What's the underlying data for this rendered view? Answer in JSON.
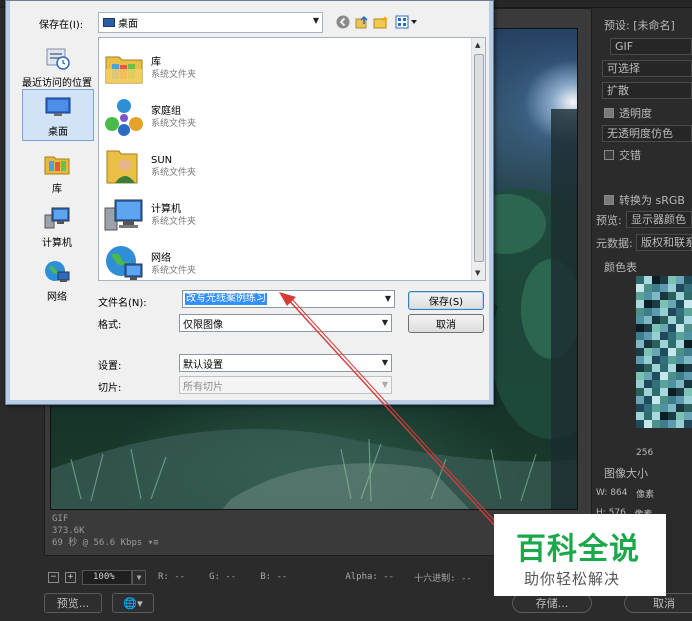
{
  "dialog": {
    "save_in_label": "保存在(I):",
    "location_value": "桌面",
    "places": [
      {
        "label": "最近访问的位置",
        "icon": "recent-places-icon"
      },
      {
        "label": "桌面",
        "icon": "desktop-icon",
        "selected": true
      },
      {
        "label": "库",
        "icon": "libraries-icon"
      },
      {
        "label": "计算机",
        "icon": "computer-icon"
      },
      {
        "label": "网络",
        "icon": "network-icon"
      }
    ],
    "files": [
      {
        "name": "库",
        "type": "系统文件夹",
        "icon": "libraries-folder-icon"
      },
      {
        "name": "家庭组",
        "type": "系统文件夹",
        "icon": "homegroup-icon"
      },
      {
        "name": "SUN",
        "type": "系统文件夹",
        "icon": "user-folder-icon"
      },
      {
        "name": "计算机",
        "type": "系统文件夹",
        "icon": "computer-icon"
      },
      {
        "name": "网络",
        "type": "系统文件夹",
        "icon": "network-icon"
      }
    ],
    "filename_label": "文件名(N):",
    "filename_value": "改写光线案例练习",
    "format_label": "格式:",
    "format_value": "仅限图像",
    "settings_label": "设置:",
    "settings_value": "默认设置",
    "slices_label": "切片:",
    "slices_value": "所有切片",
    "save_button": "保存(S)",
    "cancel_button": "取消"
  },
  "right_panel": {
    "preset_label": "预设:",
    "preset_value": "[未命名]",
    "format_value": "GIF",
    "reduction_value": "可选择",
    "dither_value": "扩散",
    "transparency_label": "透明度",
    "matte_value": "无透明度仿色",
    "interlaced_label": "交错",
    "convert_srgb_label": "转换为 sRGB",
    "preview_label": "预览:",
    "preview_value": "显示器颜色",
    "metadata_label": "元数据:",
    "metadata_value": "版权和联系",
    "color_table_label": "颜色表",
    "color_count": "256",
    "image_size_label": "图像大小",
    "width_label": "W:",
    "width_value": "864",
    "height_label": "H:",
    "height_value": "576",
    "unit": "像素"
  },
  "preview_info": {
    "format": "GIF",
    "size": "373.6K",
    "time": "69 秒 @ 56.6 Kbps"
  },
  "bottom_bar": {
    "zoom": "100%",
    "r_label": "R:",
    "r_value": "--",
    "g_label": "G:",
    "g_value": "--",
    "b_label": "B:",
    "b_value": "--",
    "alpha_label": "Alpha:",
    "alpha_value": "--",
    "hex_label": "十六进制:",
    "hex_value": "--"
  },
  "buttons": {
    "preview": "预览...",
    "save": "存储...",
    "cancel": "取消"
  },
  "watermark": {
    "title": "百科全说",
    "subtitle": "助你轻松解决"
  },
  "colors": {
    "annotation_red": "#d83a3a",
    "selection_blue": "#3390ff",
    "watermark_green": "#1aa84a"
  }
}
